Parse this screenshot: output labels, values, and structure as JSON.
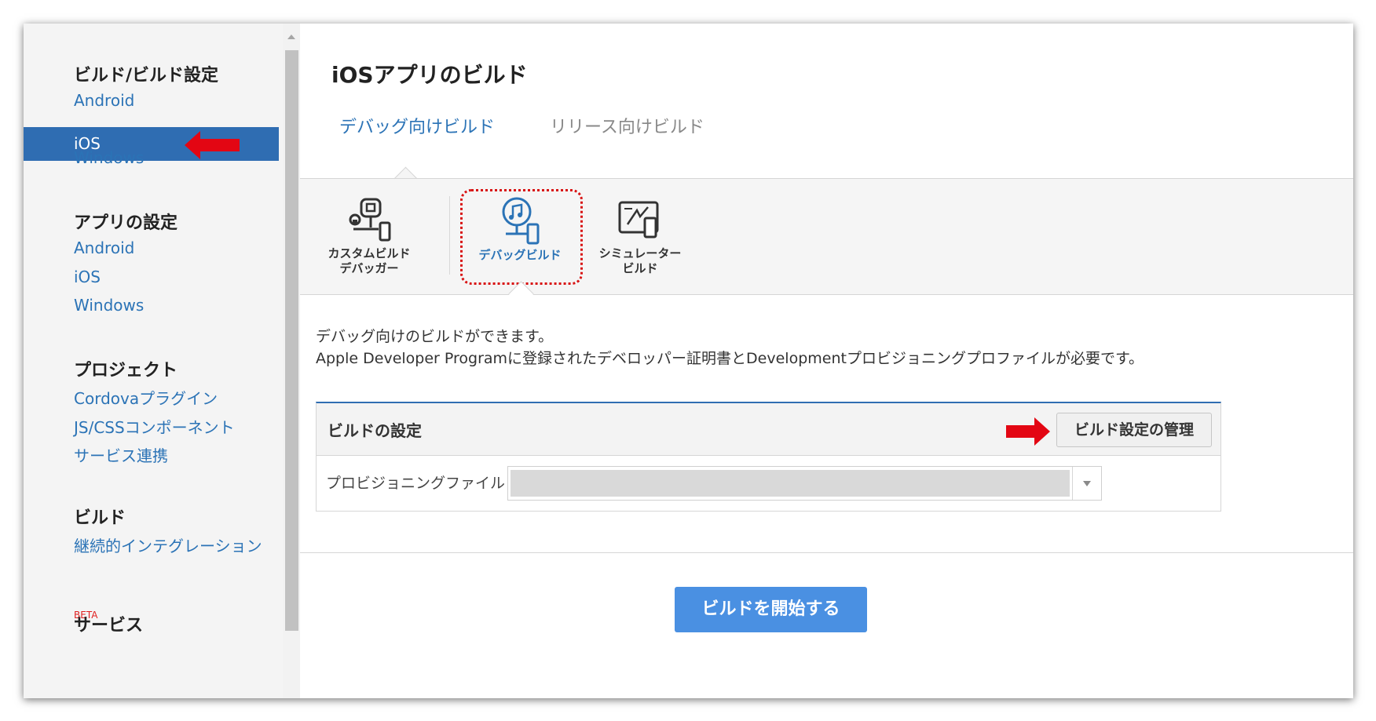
{
  "sidebar": {
    "sections": [
      {
        "heading": "ビルド/ビルド設定",
        "items": [
          "Android",
          "iOS",
          "Windows"
        ]
      },
      {
        "heading": "アプリの設定",
        "items": [
          "Android",
          "iOS",
          "Windows"
        ]
      },
      {
        "heading": "プロジェクト",
        "items": [
          "Cordovaプラグイン",
          "JS/CSSコンポーネント",
          "サービス連携"
        ]
      },
      {
        "heading": "ビルド",
        "items": [
          "継続的インテグレーション"
        ],
        "badge": "BETA"
      },
      {
        "heading": "サービス"
      }
    ],
    "active_item": "iOS"
  },
  "main": {
    "title": "iOSアプリのビルド",
    "tabs": [
      "デバッグ向けビルド",
      "リリース向けビルド"
    ],
    "active_tab": "デバッグ向けビルド",
    "build_types": [
      {
        "label_line1": "カスタムビルド",
        "label_line2": "デバッガー",
        "icon": "custom-build-debugger-icon"
      },
      {
        "label_line1": "デバッグビルド",
        "label_line2": "",
        "icon": "debug-build-icon"
      },
      {
        "label_line1": "シミュレーター",
        "label_line2": "ビルド",
        "icon": "simulator-build-icon"
      }
    ],
    "description_line1": "デバッグ向けのビルドができます。",
    "description_line2": "Apple Developer Programに登録されたデベロッパー証明書とDevelopmentプロビジョニングプロファイルが必要です。",
    "settings": {
      "title": "ビルドの設定",
      "manage_button": "ビルド設定の管理",
      "provisioning_label": "プロビジョニングファイル",
      "provisioning_value": ""
    },
    "start_button": "ビルドを開始する"
  },
  "colors": {
    "accent": "#2f6db2",
    "link": "#2b73b6",
    "primary_button": "#4a90e2",
    "highlight": "#d81313"
  }
}
